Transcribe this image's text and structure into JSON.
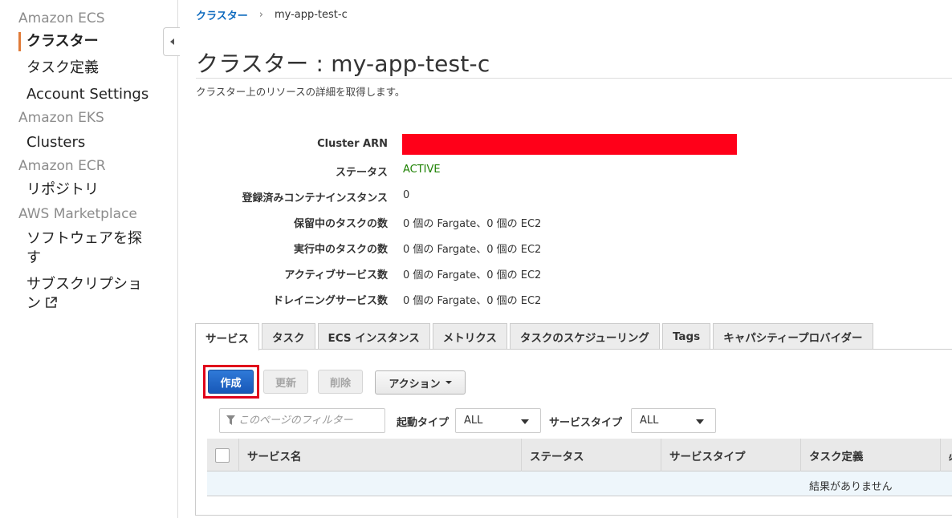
{
  "sidebar": {
    "sections": [
      {
        "title": "Amazon ECS",
        "items": [
          "クラスター",
          "タスク定義",
          "Account Settings"
        ]
      },
      {
        "title": "Amazon EKS",
        "items": [
          "Clusters"
        ]
      },
      {
        "title": "Amazon ECR",
        "items": [
          "リポジトリ"
        ]
      },
      {
        "title": "AWS Marketplace",
        "items": [
          "ソフトウェアを探",
          "す",
          "サブスクリプショ",
          "ン"
        ]
      }
    ],
    "active_item": "クラスター"
  },
  "breadcrumb": {
    "root": "クラスター",
    "separator": "›",
    "current": "my-app-test-c"
  },
  "page": {
    "title": "クラスター : my-app-test-c",
    "subtitle": "クラスター上のリソースの詳細を取得します。"
  },
  "details": {
    "cluster_arn_label": "Cluster ARN",
    "status_label": "ステータス",
    "status_value": "ACTIVE",
    "registered_instances_label": "登録済みコンテナインスタンス",
    "registered_instances_value": "0",
    "pending_tasks_label": "保留中のタスクの数",
    "pending_tasks_value": "0 個の Fargate、0 個の EC2",
    "running_tasks_label": "実行中のタスクの数",
    "running_tasks_value": "0 個の Fargate、0 個の EC2",
    "active_services_label": "アクティブサービス数",
    "active_services_value": "0 個の Fargate、0 個の EC2",
    "draining_services_label": "ドレイニングサービス数",
    "draining_services_value": "0 個の Fargate、0 個の EC2"
  },
  "tabs": [
    "サービス",
    "タスク",
    "ECS インスタンス",
    "メトリクス",
    "タスクのスケジューリング",
    "Tags",
    "キャパシティープロバイダー"
  ],
  "actions": {
    "create": "作成",
    "update": "更新",
    "delete": "削除",
    "actions": "アクション"
  },
  "filter": {
    "placeholder": "このページのフィルター",
    "launch_type_label": "起動タイプ",
    "launch_type_value": "ALL",
    "service_type_label": "サービスタイプ",
    "service_type_value": "ALL"
  },
  "table": {
    "columns": [
      "サービス名",
      "ステータス",
      "サービスタイプ",
      "タスク定義",
      "必"
    ],
    "empty_message": "結果がありません"
  },
  "colors": {
    "accent": "#e07b39",
    "link": "#0f6bbf",
    "primary": "#1858b8",
    "active_status": "#1d8102",
    "redaction": "#ff0019",
    "highlight": "#e0001b"
  }
}
